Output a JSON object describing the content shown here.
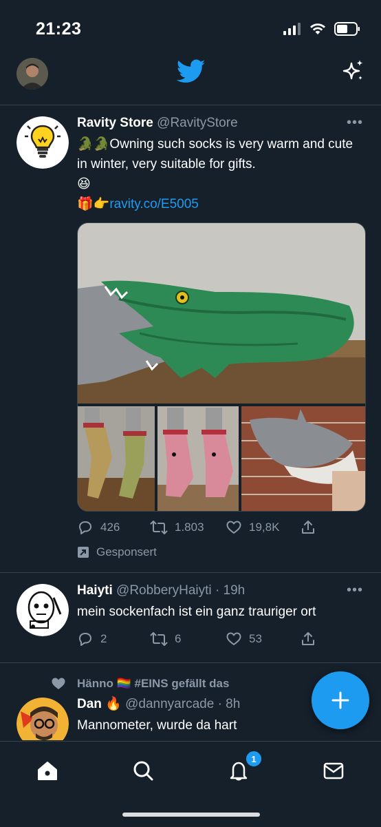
{
  "status_bar": {
    "time": "21:23"
  },
  "tweets": [
    {
      "name": "Ravity Store",
      "handle": "@RavityStore",
      "text_line1_emoji": "🐊🐊",
      "text_line1": "Owning such socks is very warm and cute in winter, very suitable for gifts.",
      "text_line2_emoji": "😆",
      "text_line3_emoji": "🎁👉",
      "link": "ravity.co/E5005",
      "replies": "426",
      "retweets": "1.803",
      "likes": "19,8K",
      "sponsored": "Gesponsert"
    },
    {
      "name": "Haiyti",
      "handle": "@RobberyHaiyti",
      "time": "· 19h",
      "text": "mein sockenfach ist ein ganz trauriger ort",
      "replies": "2",
      "retweets": "6",
      "likes": "53"
    },
    {
      "liked_by": "Hänno 🏳️‍🌈 #EINS gefällt das",
      "name": "Dan 🔥",
      "handle": "@dannyarcade",
      "time": "· 8h",
      "text": "Mannometer, wurde da hart"
    }
  ],
  "tabbar": {
    "notifications_badge": "1"
  },
  "colors": {
    "background": "#15202b",
    "accent": "#1d9bf0",
    "muted": "#8b98a5",
    "divider": "#38444d"
  }
}
